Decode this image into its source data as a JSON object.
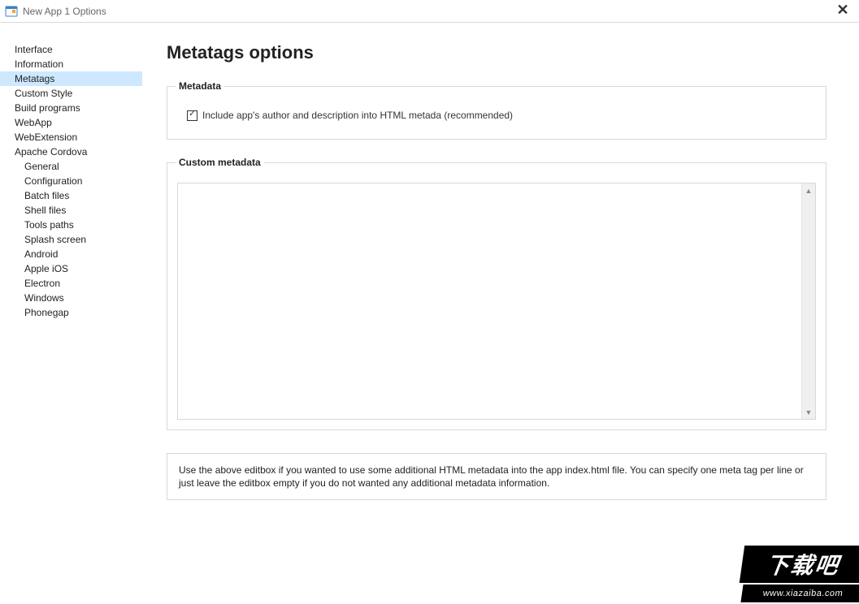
{
  "window": {
    "title": "New App 1 Options",
    "close_glyph": "✕"
  },
  "sidebar": {
    "items": [
      {
        "label": "Interface",
        "child": false,
        "selected": false
      },
      {
        "label": "Information",
        "child": false,
        "selected": false
      },
      {
        "label": "Metatags",
        "child": false,
        "selected": true
      },
      {
        "label": "Custom Style",
        "child": false,
        "selected": false
      },
      {
        "label": "Build programs",
        "child": false,
        "selected": false
      },
      {
        "label": "WebApp",
        "child": false,
        "selected": false
      },
      {
        "label": "WebExtension",
        "child": false,
        "selected": false
      },
      {
        "label": "Apache Cordova",
        "child": false,
        "selected": false
      },
      {
        "label": "General",
        "child": true,
        "selected": false
      },
      {
        "label": "Configuration",
        "child": true,
        "selected": false
      },
      {
        "label": "Batch files",
        "child": true,
        "selected": false
      },
      {
        "label": "Shell files",
        "child": true,
        "selected": false
      },
      {
        "label": "Tools paths",
        "child": true,
        "selected": false
      },
      {
        "label": "Splash screen",
        "child": true,
        "selected": false
      },
      {
        "label": "Android",
        "child": true,
        "selected": false
      },
      {
        "label": "Apple iOS",
        "child": true,
        "selected": false
      },
      {
        "label": "Electron",
        "child": true,
        "selected": false
      },
      {
        "label": "Windows",
        "child": true,
        "selected": false
      },
      {
        "label": "Phonegap",
        "child": true,
        "selected": false
      }
    ]
  },
  "page": {
    "title": "Metatags options",
    "metadata_group": {
      "legend": "Metadata",
      "include_checkbox": {
        "checked": true,
        "label": "Include app's author and description into HTML metada (recommended)"
      }
    },
    "custom_group": {
      "legend": "Custom metadata",
      "editbox_value": ""
    },
    "hint": "Use the above editbox if you wanted to use some additional HTML metadata into the app index.html file. You can specify one meta tag per line or just leave the editbox empty if you do not wanted any additional metadata information."
  },
  "watermark": {
    "top": "下载吧",
    "bottom": "www.xiazaiba.com"
  }
}
